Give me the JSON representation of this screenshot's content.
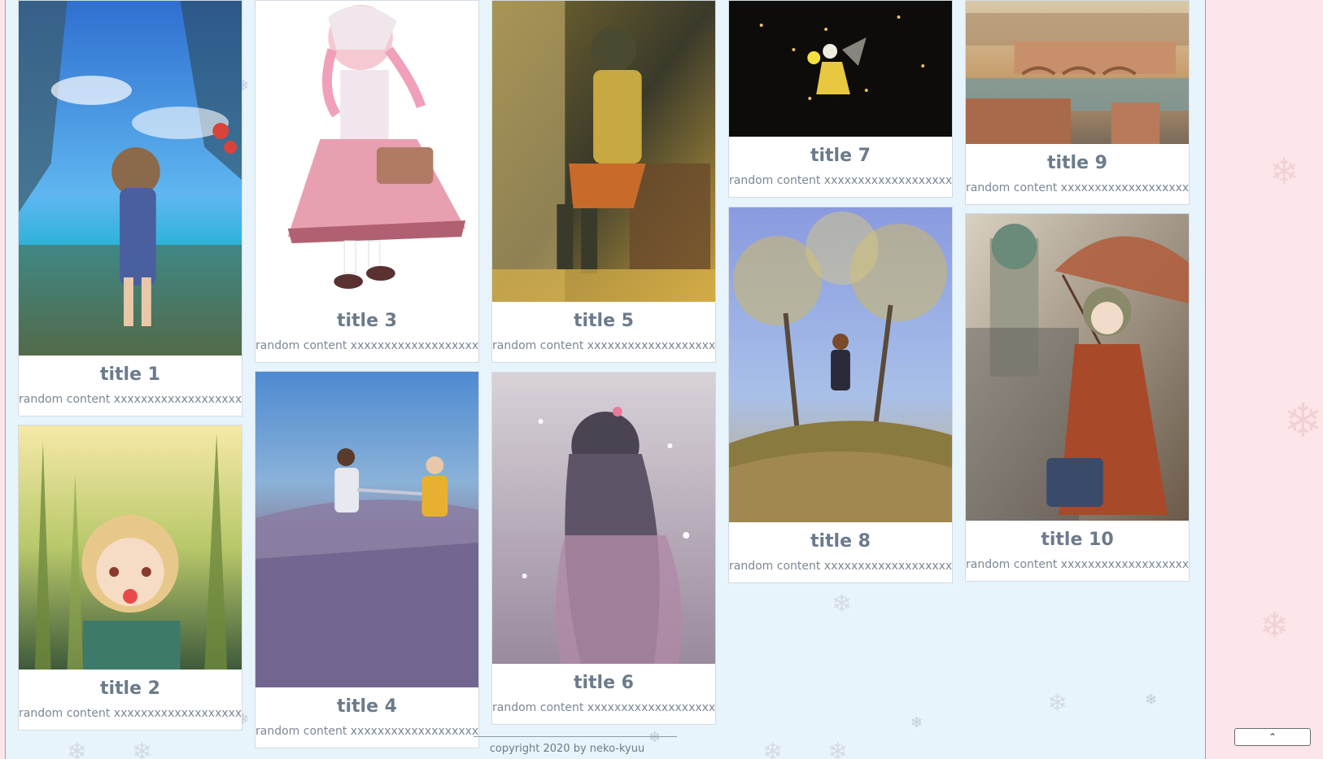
{
  "cards": [
    {
      "title": "title 1",
      "content": "random content xxxxxxxxxxxxxxxxxxx",
      "image": "girl-with-hat-by-sea-illustration"
    },
    {
      "title": "title 2",
      "content": "random content xxxxxxxxxxxxxxxxxxx",
      "image": "child-in-cornfield-illustration"
    },
    {
      "title": "title 3",
      "content": "random content xxxxxxxxxxxxxxxxxxx",
      "image": "pink-dress-girl-illustration"
    },
    {
      "title": "title 4",
      "content": "random content xxxxxxxxxxxxxxxxxxx",
      "image": "two-figures-in-field-illustration"
    },
    {
      "title": "title 5",
      "content": "random content xxxxxxxxxxxxxxxxxxx",
      "image": "girl-in-classroom-illustration"
    },
    {
      "title": "title 6",
      "content": "random content xxxxxxxxxxxxxxxxxxx",
      "image": "girl-in-snow-illustration"
    },
    {
      "title": "title 7",
      "content": "random content xxxxxxxxxxxxxxxxxxx",
      "image": "fairy-night-sky-illustration"
    },
    {
      "title": "title 8",
      "content": "random content xxxxxxxxxxxxxxxxxxx",
      "image": "girl-under-autumn-trees-illustration"
    },
    {
      "title": "title 9",
      "content": "random content xxxxxxxxxxxxxxxxxxx",
      "image": "bridge-cityscape-illustration"
    },
    {
      "title": "title 10",
      "content": "random content xxxxxxxxxxxxxxxxxxx",
      "image": "girl-with-umbrella-illustration"
    }
  ],
  "footer": {
    "copyright": "copyright 2020 by neko-kyuu"
  },
  "back_to_top": {
    "label": "⌃",
    "icon": "chevron-up-icon"
  },
  "colors": {
    "background": "#e8f4fb",
    "side_panel": "#fde6ea",
    "title_text": "#6b7b8c"
  }
}
